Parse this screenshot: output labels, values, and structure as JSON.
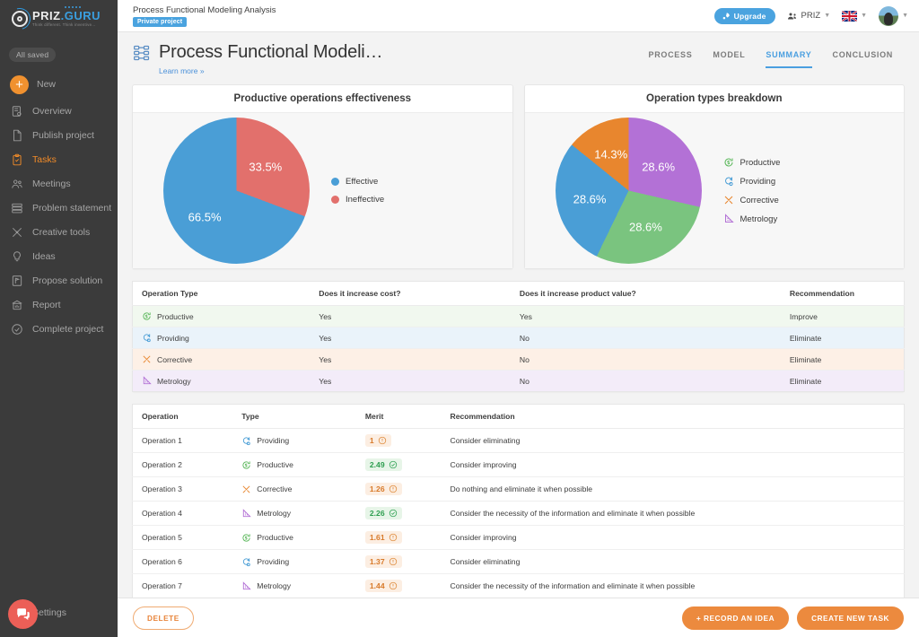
{
  "sidebar": {
    "logo": {
      "name_a": "PRIZ",
      "name_b": ".GURU",
      "tagline": "Think different. Think inventive..."
    },
    "saved_badge": "All saved",
    "new_label": "New",
    "items": [
      {
        "label": "Overview",
        "icon": "overview-icon"
      },
      {
        "label": "Publish project",
        "icon": "document-icon"
      },
      {
        "label": "Tasks",
        "icon": "clipboard-check-icon"
      },
      {
        "label": "Meetings",
        "icon": "people-icon"
      },
      {
        "label": "Problem statement",
        "icon": "layers-icon"
      },
      {
        "label": "Creative tools",
        "icon": "tools-icon"
      },
      {
        "label": "Ideas",
        "icon": "lightbulb-icon"
      },
      {
        "label": "Propose solution",
        "icon": "flag-board-icon"
      },
      {
        "label": "Report",
        "icon": "report-icon"
      },
      {
        "label": "Complete project",
        "icon": "check-circle-icon"
      }
    ],
    "active_item": "Tasks",
    "settings_label": "Settings"
  },
  "topbar": {
    "project_name": "Process Functional Modeling Analysis",
    "privacy_badge": "Private project",
    "upgrade_label": "Upgrade",
    "org_label": "PRIZ",
    "language": "EN"
  },
  "page": {
    "title": "Process Functional Modeli…",
    "learn_more": "Learn more »",
    "tabs": [
      {
        "label": "PROCESS",
        "active": false
      },
      {
        "label": "MODEL",
        "active": false
      },
      {
        "label": "SUMMARY",
        "active": true
      },
      {
        "label": "CONCLUSION",
        "active": false
      }
    ]
  },
  "chart_data": [
    {
      "type": "pie",
      "title": "Productive operations effectiveness",
      "categories": [
        "Effective",
        "Ineffective"
      ],
      "values": [
        66.5,
        33.5
      ],
      "labels": [
        "66.5%",
        "33.5%"
      ],
      "colors": [
        "#4a9ed6",
        "#e2706c"
      ],
      "legend_position": "right",
      "start_angle": -10
    },
    {
      "type": "pie",
      "title": "Operation types breakdown",
      "categories": [
        "Productive",
        "Providing",
        "Corrective",
        "Metrology"
      ],
      "values": [
        28.6,
        28.6,
        14.3,
        28.6
      ],
      "labels": [
        "28.6%",
        "28.6%",
        "14.3%",
        "28.6%"
      ],
      "colors": [
        "#7ac47f",
        "#4a9ed6",
        "#e8862e",
        "#b371d6"
      ],
      "legend_position": "right",
      "start_angle": 0
    }
  ],
  "type_table": {
    "columns": [
      "Operation Type",
      "Does it increase cost?",
      "Does it increase product value?",
      "Recommendation"
    ],
    "rows": [
      {
        "type": "Productive",
        "cost": "Yes",
        "value": "Yes",
        "recommendation": "Improve"
      },
      {
        "type": "Providing",
        "cost": "Yes",
        "value": "No",
        "recommendation": "Eliminate"
      },
      {
        "type": "Corrective",
        "cost": "Yes",
        "value": "No",
        "recommendation": "Eliminate"
      },
      {
        "type": "Metrology",
        "cost": "Yes",
        "value": "No",
        "recommendation": "Eliminate"
      }
    ]
  },
  "operations_table": {
    "columns": [
      "Operation",
      "Type",
      "Merit",
      "Recommendation"
    ],
    "rows": [
      {
        "operation": "Operation 1",
        "type": "Providing",
        "merit": "1",
        "merit_level": "low",
        "recommendation": "Consider eliminating"
      },
      {
        "operation": "Operation 2",
        "type": "Productive",
        "merit": "2.49",
        "merit_level": "high",
        "recommendation": "Consider improving"
      },
      {
        "operation": "Operation 3",
        "type": "Corrective",
        "merit": "1.26",
        "merit_level": "low",
        "recommendation": "Do nothing and eliminate it when possible"
      },
      {
        "operation": "Operation 4",
        "type": "Metrology",
        "merit": "2.26",
        "merit_level": "high",
        "recommendation": "Consider the necessity of the information and eliminate it when possible"
      },
      {
        "operation": "Operation 5",
        "type": "Productive",
        "merit": "1.61",
        "merit_level": "low",
        "recommendation": "Consider improving"
      },
      {
        "operation": "Operation 6",
        "type": "Providing",
        "merit": "1.37",
        "merit_level": "low",
        "recommendation": "Consider eliminating"
      },
      {
        "operation": "Operation 7",
        "type": "Metrology",
        "merit": "1.44",
        "merit_level": "low",
        "recommendation": "Consider the necessity of the information and eliminate it when possible"
      }
    ]
  },
  "footer": {
    "delete_label": "DELETE",
    "record_idea_label": "+ RECORD AN IDEA",
    "create_task_label": "CREATE NEW TASK"
  },
  "colors": {
    "accent_orange": "#ec8a3e",
    "accent_blue": "#4a9fe0",
    "productive": "#7ac47f",
    "providing": "#4a9ed6",
    "corrective": "#e8862e",
    "metrology": "#b371d6"
  }
}
